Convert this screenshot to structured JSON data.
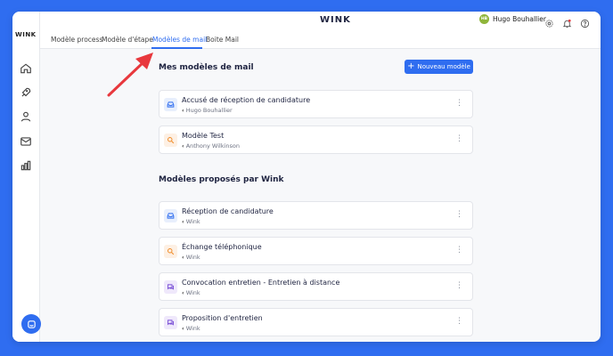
{
  "app": {
    "brand": "WINK",
    "logo_small": "WINK"
  },
  "topbar": {
    "user_initials": "HB",
    "user_name": "Hugo Bouhallier"
  },
  "tabs": [
    {
      "label": "Modèle process"
    },
    {
      "label": "Modèle d'étape"
    },
    {
      "label": "Modèles de mail",
      "active": true
    },
    {
      "label": "Boite Mail"
    }
  ],
  "my_templates": {
    "title": "Mes modèles de mail",
    "new_button": "Nouveau modèle",
    "items": [
      {
        "title": "Accusé de réception de candidature",
        "author": "Hugo Bouhallier",
        "icon": "inbox-icon"
      },
      {
        "title": "Modèle Test",
        "author": "Anthony Wilkinson",
        "icon": "search-icon"
      }
    ]
  },
  "suggested_templates": {
    "title": "Modèles proposés par Wink",
    "items": [
      {
        "title": "Réception de candidature",
        "author": "Wink",
        "icon": "inbox-icon"
      },
      {
        "title": "Échange téléphonique",
        "author": "Wink",
        "icon": "search-icon"
      },
      {
        "title": "Convocation entretien - Entretien à distance",
        "author": "Wink",
        "icon": "chat-icon"
      },
      {
        "title": "Proposition d'entretien",
        "author": "Wink",
        "icon": "chat-icon"
      }
    ]
  },
  "colors": {
    "accent": "#2f6df0",
    "arrow": "#e8383d",
    "background": "#2f6df0"
  }
}
